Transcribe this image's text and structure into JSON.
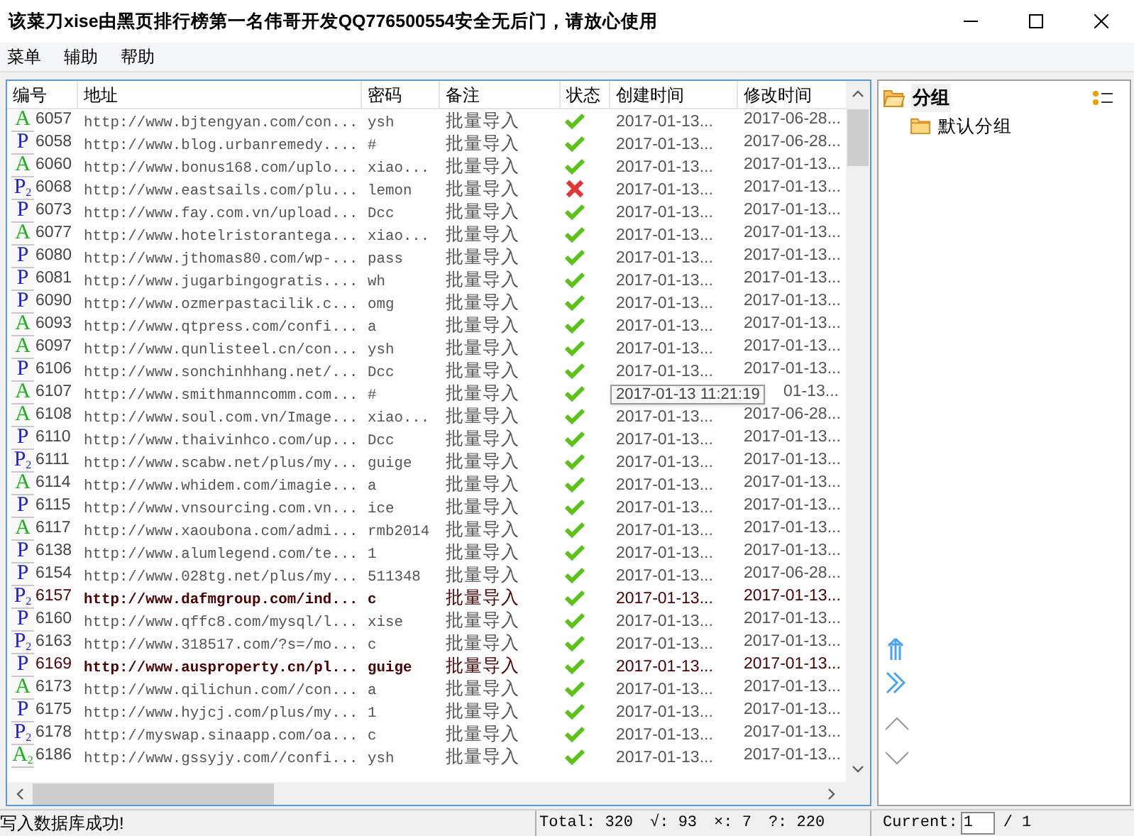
{
  "window": {
    "title": "该菜刀xise由黑页排行榜第一名伟哥开发QQ776500554安全无后门，请放心使用"
  },
  "menu": [
    "菜单",
    "辅助",
    "帮助"
  ],
  "table": {
    "columns": [
      "编号",
      "地址",
      "密码",
      "备注",
      "状态",
      "创建时间",
      "修改时间"
    ],
    "rows": [
      {
        "kind": "a",
        "tag": "A",
        "id": "6057",
        "url": "http://www.bjtengyan.com/con...",
        "pwd": "ysh",
        "note": "批量导入",
        "ok": true,
        "created": "2017-01-13...",
        "modified": "2017-06-28...",
        "highlight": false
      },
      {
        "kind": "p",
        "tag": "P",
        "id": "6058",
        "url": "http://www.blog.urbanremedy....",
        "pwd": "#",
        "note": "批量导入",
        "ok": true,
        "created": "2017-01-13...",
        "modified": "2017-06-28...",
        "highlight": false
      },
      {
        "kind": "a",
        "tag": "A",
        "id": "6060",
        "url": "http://www.bonus168.com/uplo...",
        "pwd": "xiao...",
        "note": "批量导入",
        "ok": true,
        "created": "2017-01-13...",
        "modified": "2017-01-13...",
        "highlight": false
      },
      {
        "kind": "p",
        "tag": "P",
        "sub": "2",
        "id": "6068",
        "url": "http://www.eastsails.com/plu...",
        "pwd": "lemon",
        "note": "批量导入",
        "ok": false,
        "created": "2017-01-13...",
        "modified": "2017-01-13...",
        "highlight": false
      },
      {
        "kind": "p",
        "tag": "P",
        "id": "6073",
        "url": "http://www.fay.com.vn/upload...",
        "pwd": "Dcc",
        "note": "批量导入",
        "ok": true,
        "created": "2017-01-13...",
        "modified": "2017-01-13...",
        "highlight": false
      },
      {
        "kind": "a",
        "tag": "A",
        "id": "6077",
        "url": "http://www.hotelristorantega...",
        "pwd": "xiao...",
        "note": "批量导入",
        "ok": true,
        "created": "2017-01-13...",
        "modified": "2017-01-13...",
        "highlight": false
      },
      {
        "kind": "p",
        "tag": "P",
        "id": "6080",
        "url": "http://www.jthomas80.com/wp-...",
        "pwd": "pass",
        "note": "批量导入",
        "ok": true,
        "created": "2017-01-13...",
        "modified": "2017-01-13...",
        "highlight": false
      },
      {
        "kind": "p",
        "tag": "P",
        "id": "6081",
        "url": "http://www.jugarbingogratis....",
        "pwd": "wh",
        "note": "批量导入",
        "ok": true,
        "created": "2017-01-13...",
        "modified": "2017-01-13...",
        "highlight": false
      },
      {
        "kind": "p",
        "tag": "P",
        "id": "6090",
        "url": "http://www.ozmerpastacilik.c...",
        "pwd": "omg",
        "note": "批量导入",
        "ok": true,
        "created": "2017-01-13...",
        "modified": "2017-01-13...",
        "highlight": false
      },
      {
        "kind": "a",
        "tag": "A",
        "id": "6093",
        "url": "http://www.qtpress.com/confi...",
        "pwd": "a",
        "note": "批量导入",
        "ok": true,
        "created": "2017-01-13...",
        "modified": "2017-01-13...",
        "highlight": false
      },
      {
        "kind": "a",
        "tag": "A",
        "id": "6097",
        "url": "http://www.qunlisteel.cn/con...",
        "pwd": "ysh",
        "note": "批量导入",
        "ok": true,
        "created": "2017-01-13...",
        "modified": "2017-01-13...",
        "highlight": false
      },
      {
        "kind": "p",
        "tag": "P",
        "id": "6106",
        "url": "http://www.sonchinhhang.net/...",
        "pwd": "Dcc",
        "note": "批量导入",
        "ok": true,
        "created": "2017-01-13...",
        "modified": "2017-01-13...",
        "highlight": false
      },
      {
        "kind": "a",
        "tag": "A",
        "id": "6107",
        "url": "http://www.smithmanncomm.com...",
        "pwd": "#",
        "note": "批量导入",
        "ok": true,
        "tooltip": "2017-01-13 11:21:19",
        "modified": "01-13...",
        "highlight": false
      },
      {
        "kind": "a",
        "tag": "A",
        "id": "6108",
        "url": "http://www.soul.com.vn/Image...",
        "pwd": "xiao...",
        "note": "批量导入",
        "ok": true,
        "created": "2017-01-13...",
        "modified": "2017-06-28...",
        "highlight": false
      },
      {
        "kind": "p",
        "tag": "P",
        "id": "6110",
        "url": "http://www.thaivinhco.com/up...",
        "pwd": "Dcc",
        "note": "批量导入",
        "ok": true,
        "created": "2017-01-13...",
        "modified": "2017-01-13...",
        "highlight": false
      },
      {
        "kind": "p",
        "tag": "P",
        "sub": "2",
        "id": "6111",
        "url": "http://www.scabw.net/plus/my...",
        "pwd": "guige",
        "note": "批量导入",
        "ok": true,
        "created": "2017-01-13...",
        "modified": "2017-01-13...",
        "highlight": false
      },
      {
        "kind": "a",
        "tag": "A",
        "id": "6114",
        "url": "http://www.whidem.com/imagie...",
        "pwd": "a",
        "note": "批量导入",
        "ok": true,
        "created": "2017-01-13...",
        "modified": "2017-01-13...",
        "highlight": false
      },
      {
        "kind": "p",
        "tag": "P",
        "id": "6115",
        "url": "http://www.vnsourcing.com.vn...",
        "pwd": "ice",
        "note": "批量导入",
        "ok": true,
        "created": "2017-01-13...",
        "modified": "2017-01-13...",
        "highlight": false
      },
      {
        "kind": "a",
        "tag": "A",
        "id": "6117",
        "url": "http://www.xaoubona.com/admi...",
        "pwd": "rmb2014",
        "note": "批量导入",
        "ok": true,
        "created": "2017-01-13...",
        "modified": "2017-01-13...",
        "highlight": false
      },
      {
        "kind": "p",
        "tag": "P",
        "id": "6138",
        "url": "http://www.alumlegend.com/te...",
        "pwd": "1",
        "note": "批量导入",
        "ok": true,
        "created": "2017-01-13...",
        "modified": "2017-01-13...",
        "highlight": false
      },
      {
        "kind": "p",
        "tag": "P",
        "id": "6154",
        "url": "http://www.028tg.net/plus/my...",
        "pwd": "511348",
        "note": "批量导入",
        "ok": true,
        "created": "2017-01-13...",
        "modified": "2017-06-28...",
        "highlight": false
      },
      {
        "kind": "p",
        "tag": "P",
        "sub": "2",
        "id": "6157",
        "url": "http://www.dafmgroup.com/ind...",
        "pwd": "c",
        "note": "批量导入",
        "ok": true,
        "created": "2017-01-13...",
        "modified": "2017-01-13...",
        "highlight": true
      },
      {
        "kind": "p",
        "tag": "P",
        "id": "6160",
        "url": "http://www.qffc8.com/mysql/l...",
        "pwd": "xise",
        "note": "批量导入",
        "ok": true,
        "created": "2017-01-13...",
        "modified": "2017-01-13...",
        "highlight": false
      },
      {
        "kind": "p",
        "tag": "P",
        "sub": "2",
        "id": "6163",
        "url": "http://www.318517.com/?s=/mo...",
        "pwd": "c",
        "note": "批量导入",
        "ok": true,
        "created": "2017-01-13...",
        "modified": "2017-01-13...",
        "highlight": false
      },
      {
        "kind": "p",
        "tag": "P",
        "id": "6169",
        "url": "http://www.ausproperty.cn/pl...",
        "pwd": "guige",
        "note": "批量导入",
        "ok": true,
        "created": "2017-01-13...",
        "modified": "2017-01-13...",
        "highlight": true
      },
      {
        "kind": "a",
        "tag": "A",
        "id": "6173",
        "url": "http://www.qilichun.com//con...",
        "pwd": "a",
        "note": "批量导入",
        "ok": true,
        "created": "2017-01-13...",
        "modified": "2017-01-13...",
        "highlight": false
      },
      {
        "kind": "p",
        "tag": "P",
        "id": "6175",
        "url": "http://www.hyjcj.com/plus/my...",
        "pwd": "1",
        "note": "批量导入",
        "ok": true,
        "created": "2017-01-13...",
        "modified": "2017-01-13...",
        "highlight": false
      },
      {
        "kind": "p",
        "tag": "P",
        "sub": "2",
        "id": "6178",
        "url": "http://myswap.sinaapp.com/oa...",
        "pwd": "c",
        "note": "批量导入",
        "ok": true,
        "created": "2017-01-13...",
        "modified": "2017-01-13...",
        "highlight": false
      },
      {
        "kind": "a",
        "tag": "A",
        "sub": "2",
        "id": "6186",
        "url": "http://www.gssyjy.com//confi...",
        "pwd": "ysh",
        "note": "批量导入",
        "ok": true,
        "created": "2017-01-13...",
        "modified": "2017-01-13...",
        "highlight": false
      }
    ]
  },
  "groups": {
    "label": "分组",
    "children": [
      {
        "label": "默认分组"
      }
    ]
  },
  "status_bar": {
    "message": "写入数据库成功!",
    "total": "Total: 320",
    "ok": "√: 93",
    "fail": "×: 7",
    "unknown": "?: 220",
    "current_label": "Current:",
    "current_page": "1",
    "pages": "/ 1"
  }
}
